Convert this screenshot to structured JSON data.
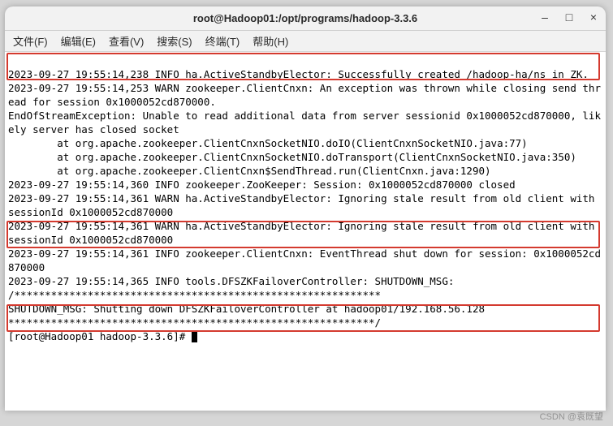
{
  "window": {
    "title": "root@Hadoop01:/opt/programs/hadoop-3.3.6"
  },
  "menus": {
    "file": "文件(F)",
    "edit": "编辑(E)",
    "view": "查看(V)",
    "search": "搜索(S)",
    "terminal": "终端(T)",
    "help": "帮助(H)"
  },
  "log": {
    "l01": "2023-09-27 19:55:14,238 INFO ha.ActiveStandbyElector: Successfully created /hadoop-ha/ns in ZK.",
    "l02": "2023-09-27 19:55:14,253 WARN zookeeper.ClientCnxn: An exception was thrown while closing send thread for session 0x1000052cd870000.",
    "l03": "EndOfStreamException: Unable to read additional data from server sessionid 0x1000052cd870000, likely server has closed socket",
    "l04": "        at org.apache.zookeeper.ClientCnxnSocketNIO.doIO(ClientCnxnSocketNIO.java:77)",
    "l05": "        at org.apache.zookeeper.ClientCnxnSocketNIO.doTransport(ClientCnxnSocketNIO.java:350)",
    "l06": "        at org.apache.zookeeper.ClientCnxn$SendThread.run(ClientCnxn.java:1290)",
    "l07": "2023-09-27 19:55:14,360 INFO zookeeper.ZooKeeper: Session: 0x1000052cd870000 closed",
    "l08": "2023-09-27 19:55:14,361 WARN ha.ActiveStandbyElector: Ignoring stale result from old client with sessionId 0x1000052cd870000",
    "l09": "2023-09-27 19:55:14,361 WARN ha.ActiveStandbyElector: Ignoring stale result from old client with sessionId 0x1000052cd870000",
    "l10": "2023-09-27 19:55:14,361 INFO zookeeper.ClientCnxn: EventThread shut down for session: 0x1000052cd870000",
    "l11": "2023-09-27 19:55:14,365 INFO tools.DFSZKFailoverController: SHUTDOWN_MSG:",
    "l12": "/************************************************************",
    "l13": "SHUTDOWN_MSG: Shutting down DFSZKFailoverController at hadoop01/192.168.56.128",
    "l14": "************************************************************/",
    "prompt": "[root@Hadoop01 hadoop-3.3.6]# "
  },
  "watermark": "CSDN @袁既望"
}
